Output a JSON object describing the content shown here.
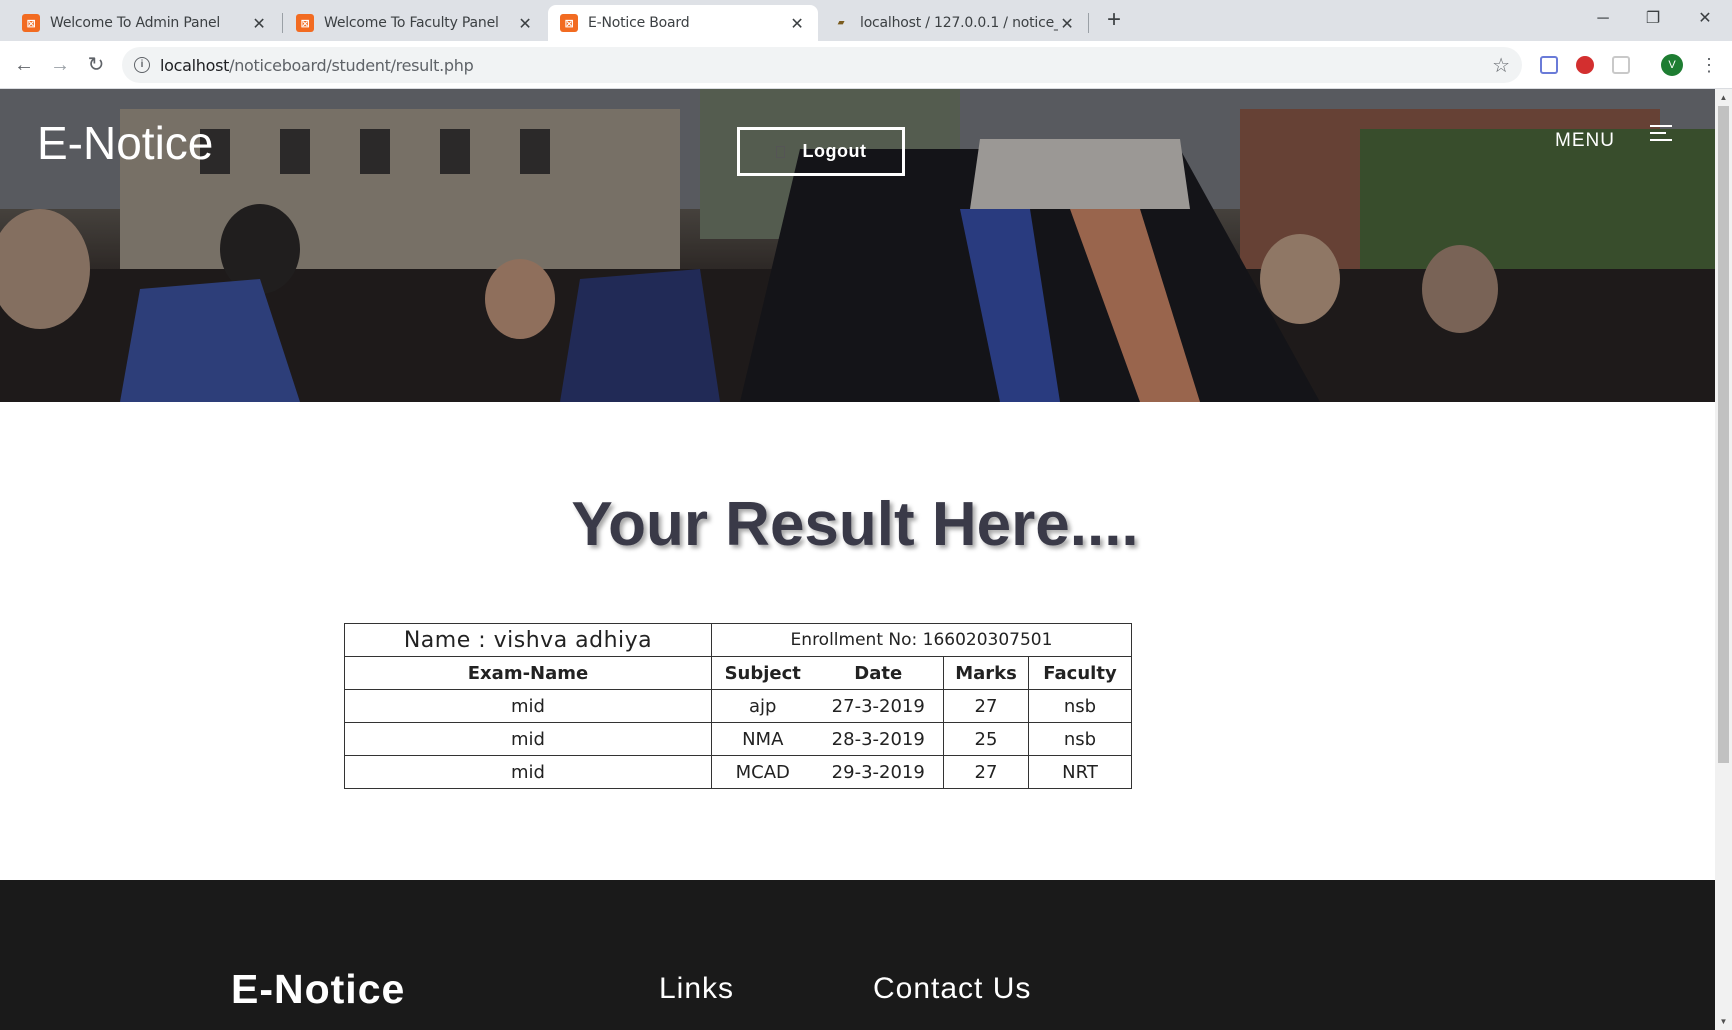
{
  "browser": {
    "tabs": [
      {
        "title": "Welcome To Admin Panel",
        "icon": "xampp-icon"
      },
      {
        "title": "Welcome To Faculty Panel",
        "icon": "xampp-icon"
      },
      {
        "title": "E-Notice Board",
        "icon": "xampp-icon",
        "active": true
      },
      {
        "title": "localhost / 127.0.0.1 / notice_boa",
        "icon": "phpmyadmin-icon"
      }
    ],
    "new_tab": "+",
    "url_host": "localhost",
    "url_path": "/noticeboard/student/result.php",
    "avatar_letter": "V"
  },
  "header": {
    "brand": "E-Notice",
    "logout_label": "Logout",
    "menu_label": "MENU"
  },
  "main": {
    "title": "Your Result Here....",
    "student_name": "Name : vishva adhiya",
    "enrollment": "Enrollment No: 166020307501",
    "columns": [
      "Exam-Name",
      "Subject",
      "Date",
      "Marks",
      "Faculty"
    ],
    "rows": [
      [
        "mid",
        "ajp",
        "27-3-2019",
        "27",
        "nsb"
      ],
      [
        "mid",
        "NMA",
        "28-3-2019",
        "25",
        "nsb"
      ],
      [
        "mid",
        "MCAD",
        "29-3-2019",
        "27",
        "NRT"
      ]
    ]
  },
  "footer": {
    "brand": "E-Notice",
    "links_heading": "Links",
    "contact_heading": "Contact Us"
  },
  "colors": {
    "title": "#3a3a48",
    "footer_bg": "#1a1a1a",
    "tab_accent": "#f26b21"
  }
}
